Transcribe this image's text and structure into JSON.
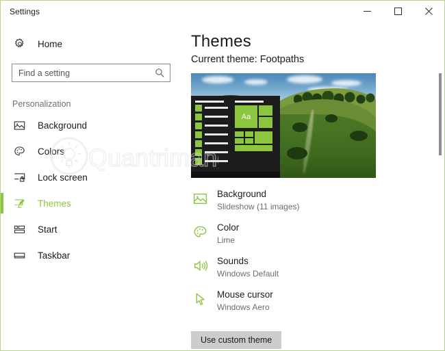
{
  "window": {
    "title": "Settings",
    "accent_color": "#8cc63f",
    "border_color": "#b6d68a",
    "controls": {
      "minimize_label": "Minimize",
      "maximize_label": "Maximize",
      "close_label": "Close"
    }
  },
  "sidebar": {
    "home_label": "Home",
    "home_icon": "gear-icon",
    "search": {
      "placeholder": "Find a setting",
      "value": "",
      "icon": "search-icon"
    },
    "section_label": "Personalization",
    "items": [
      {
        "label": "Background",
        "icon": "picture-icon",
        "selected": false
      },
      {
        "label": "Colors",
        "icon": "palette-icon",
        "selected": false
      },
      {
        "label": "Lock screen",
        "icon": "lock-screen-icon",
        "selected": false
      },
      {
        "label": "Themes",
        "icon": "themes-icon",
        "selected": true
      },
      {
        "label": "Start",
        "icon": "start-tiles-icon",
        "selected": false
      },
      {
        "label": "Taskbar",
        "icon": "taskbar-icon",
        "selected": false
      }
    ]
  },
  "main": {
    "title": "Themes",
    "current_theme_label": "Current theme:",
    "current_theme_name": "Footpaths",
    "preview": {
      "alt": "theme-preview-green-hillside-with-start-menu",
      "tile_text": "Aa",
      "accent_tile_color": "#8cc63f"
    },
    "settings": [
      {
        "title": "Background",
        "value": "Slideshow (11 images)",
        "icon": "picture-icon"
      },
      {
        "title": "Color",
        "value": "Lime",
        "icon": "palette-icon"
      },
      {
        "title": "Sounds",
        "value": "Windows Default",
        "icon": "speaker-icon"
      },
      {
        "title": "Mouse cursor",
        "value": "Windows Aero",
        "icon": "cursor-icon"
      }
    ],
    "custom_theme_button": "Use custom theme"
  },
  "watermark": {
    "text": "Quantrimang"
  }
}
